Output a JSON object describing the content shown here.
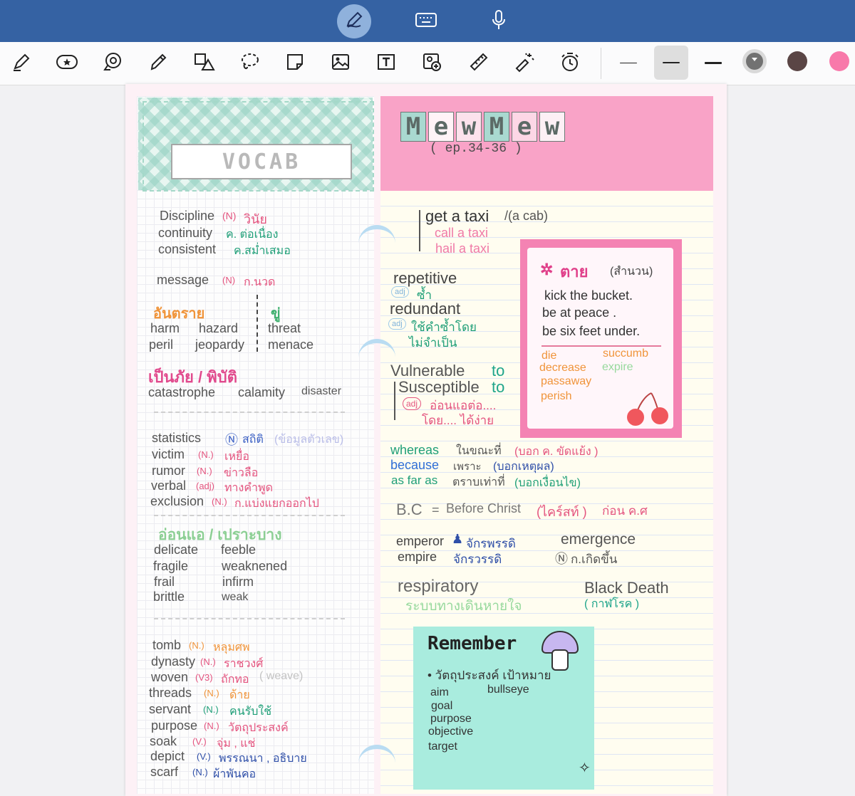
{
  "topbar": {
    "modes": [
      "pen-mode",
      "keyboard-mode",
      "voice-mode"
    ],
    "active_mode": "pen-mode",
    "color": "#3562a3"
  },
  "toolbar": {
    "tools": [
      "highlighter-icon",
      "sticker-icon",
      "lasso-comment-icon",
      "pencil-icon",
      "shapes-icon",
      "lasso-icon",
      "sticky-note-icon",
      "image-icon",
      "text-box-icon",
      "scan-icon",
      "ruler-icon",
      "laser-pointer-icon",
      "timer-icon"
    ],
    "stroke_widths": [
      "thin",
      "medium",
      "thick"
    ],
    "selected_stroke": "medium",
    "colors": [
      "#727272",
      "#5a4545",
      "#f879aa"
    ],
    "selected_color": "#727272"
  },
  "page": {
    "vocab_label": "VOCAB",
    "title_letters": [
      "M",
      "e",
      "w",
      "M",
      "e",
      "w"
    ],
    "subtitle": "( ep.34-36 )",
    "left_lines": [
      {
        "word": "Discipline",
        "pos": "(N)",
        "thai": "วินัย"
      },
      {
        "word": "continuity",
        "pos": "",
        "thai": "ค. ต่อเนื่อง"
      },
      {
        "word": "consistent",
        "pos": "",
        "thai": "ค.สม่ำเสมอ"
      },
      {
        "word": "message",
        "pos": "(N)",
        "thai": "ก.นวด"
      }
    ],
    "danger_heading": "อันตราย",
    "threat_heading": "ขู่",
    "danger_words": [
      "harm",
      "hazard",
      "peril",
      "jeopardy"
    ],
    "threat_words": [
      "threat",
      "menace"
    ],
    "disaster_heading": "เป็นภัย / พิบัติ",
    "disaster_words": [
      "catastrophe",
      "calamity",
      "disaster"
    ],
    "list2": [
      {
        "word": "statistics",
        "pos": "Ⓝ",
        "thai": "สถิติ",
        "note": "(ข้อมูลตัวเลข)"
      },
      {
        "word": "victim",
        "pos": "(N.)",
        "thai": "เหยื่อ",
        "note": ""
      },
      {
        "word": "rumor",
        "pos": "(N.)",
        "thai": "ข่าวลือ",
        "note": ""
      },
      {
        "word": "verbal",
        "pos": "(adj)",
        "thai": "ทางคำพูด",
        "note": ""
      },
      {
        "word": "exclusion",
        "pos": "(N.)",
        "thai": "ก.แบ่งแยกออกไป",
        "note": ""
      }
    ],
    "weak_heading": "อ่อนแอ / เปราะบาง",
    "weak_words_a": [
      "delicate",
      "fragile",
      "frail",
      "brittle"
    ],
    "weak_words_b": [
      "feeble",
      "weaknened",
      "infirm",
      "weak"
    ],
    "list3": [
      {
        "word": "tomb",
        "pos": "(N.)",
        "thai": "หลุมศพ"
      },
      {
        "word": "dynasty",
        "pos": "(N.)",
        "thai": "ราชวงศ์"
      },
      {
        "word": "woven",
        "pos": "(V3)",
        "thai": "ถักทอ",
        "note": "( weave)"
      },
      {
        "word": "threads",
        "pos": "(N.)",
        "thai": "ด้าย"
      },
      {
        "word": "servant",
        "pos": "(N.)",
        "thai": "คนรับใช้"
      },
      {
        "word": "purpose",
        "pos": "(N.)",
        "thai": "วัตถุประสงค์"
      },
      {
        "word": "soak",
        "pos": "(V.)",
        "thai": "จุ่ม , แช่"
      },
      {
        "word": "depict",
        "pos": "(V.)",
        "thai": "พรรณนา , อธิบาย"
      },
      {
        "word": "scarf",
        "pos": "(N.)",
        "thai": "ผ้าพันคอ"
      }
    ],
    "taxi": {
      "main": "get a taxi",
      "alt": "/(a cab)",
      "l2": "call a taxi",
      "l3": "hail a taxi"
    },
    "repetitive": {
      "word": "repetitive",
      "adj": "adj",
      "thai": "ซ้ำ"
    },
    "redundant": {
      "word": "redundant",
      "adj": "adj",
      "thai1": "ใช้คำซ้ำโดย",
      "thai2": "ไม่จำเป็น"
    },
    "vulnerable": {
      "w1": "Vulnerable",
      "w2": "Susceptible",
      "to": "to",
      "adj": "adj",
      "thai1": "อ่อนแอต่อ....",
      "thai2": "โดย.... ได้ง่าย"
    },
    "conj": [
      {
        "word": "whereas",
        "thai": "ในขณะที่",
        "note": "(บอก ค. ขัดแย้ง )"
      },
      {
        "word": "because",
        "thai": "เพราะ",
        "note": "(บอกเหตุผล)"
      },
      {
        "word": "as far as",
        "thai": "ตราบเท่าที่",
        "note": "(บอกเงื่อนไข)"
      }
    ],
    "bc": {
      "abbr": "B.C",
      "eq": "=",
      "full": "Before Christ",
      "thai": "(ไคร์สท์ )",
      "after": "ก่อน ค.ศ"
    },
    "emperor": {
      "word": "emperor",
      "thai": "จักรพรรดิ"
    },
    "empire": {
      "word": "empire",
      "thai": "จักรวรรดิ"
    },
    "emergence": {
      "word": "emergence",
      "pos": "Ⓝ",
      "thai": "ก.เกิดขึ้น"
    },
    "respiratory": {
      "word": "respiratory",
      "thai": "ระบบทางเดินหายใจ"
    },
    "blackdeath": {
      "word": "Black Death",
      "thai": "( กาฬโรค )"
    },
    "die_box": {
      "heading": "ตาย",
      "heading_note": "(สำนวน)",
      "idioms": [
        "kick the bucket.",
        "be at peace .",
        "be six feet under."
      ],
      "col1": [
        "die",
        "decrease",
        "passaway",
        "perish"
      ],
      "col2": [
        "succumb",
        "expire"
      ]
    },
    "remember": {
      "title": "Remember",
      "thai": "• วัตถุประสงค์ เป้าหมาย",
      "col1": [
        "aim",
        "goal",
        "purpose",
        "objective",
        "target"
      ],
      "col2": [
        "bullseye"
      ]
    }
  }
}
